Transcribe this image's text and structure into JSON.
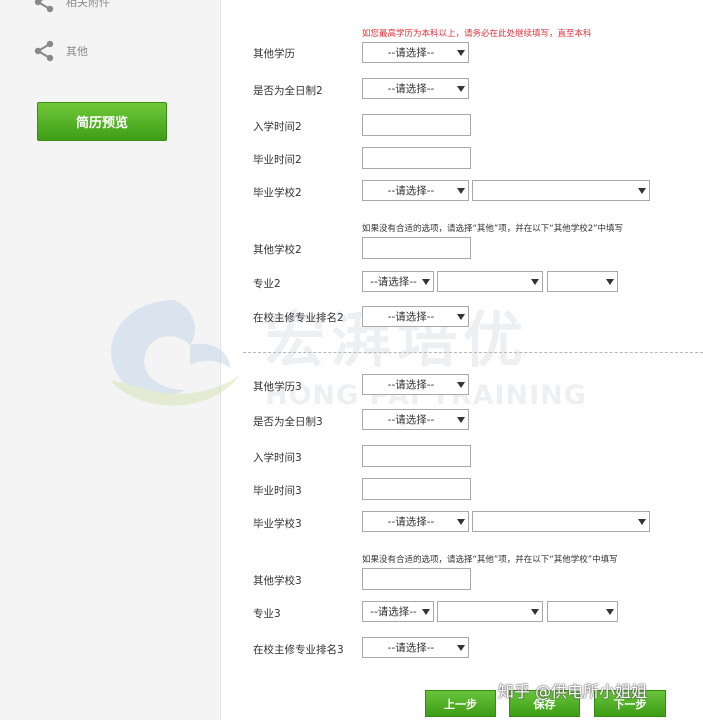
{
  "sidebar": {
    "items": [
      {
        "label": "相关附件",
        "icon": "share-icon"
      },
      {
        "label": "其他",
        "icon": "share-icon"
      }
    ],
    "preview_button": "简历预览"
  },
  "notes": {
    "top": "如您最高学历为本科以上，请务必在此处继续填写，直至本科",
    "school2_hint": "如果没有合适的选项，请选择“其他”项，并在以下“其他学校2”中填写",
    "school3_hint": "如果没有合适的选项，请选择“其他”项，并在以下“其他学校”中填写"
  },
  "select_placeholder": "--请选择--",
  "labels": {
    "other_degree": "其他学历",
    "fulltime2": "是否为全日制2",
    "enroll2": "入学时间2",
    "graduate2": "毕业时间2",
    "school2": "毕业学校2",
    "other_school2": "其他学校2",
    "major2": "专业2",
    "rank2": "在校主修专业排名2",
    "other_degree3": "其他学历3",
    "fulltime3": "是否为全日制3",
    "enroll3": "入学时间3",
    "graduate3": "毕业时间3",
    "school3": "毕业学校3",
    "other_school3": "其他学校3",
    "major3": "专业3",
    "rank3": "在校主修专业排名3"
  },
  "watermark": {
    "cn": "宏湃培优",
    "en": "HONG PAI TRAINING"
  },
  "buttons": {
    "prev": "上一步",
    "save": "保存",
    "next": "下一步"
  },
  "source_mark": "知乎 @供电所小姐姐",
  "colors": {
    "accent_green": "#4aa81e",
    "note_red": "#e0303a"
  }
}
